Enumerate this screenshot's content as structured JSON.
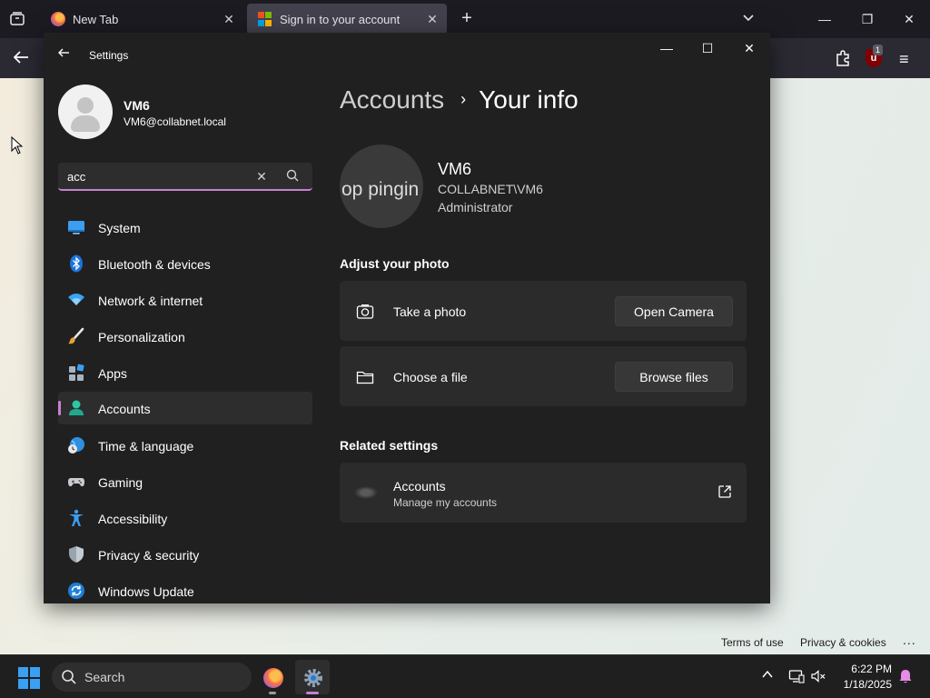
{
  "browser": {
    "tabs": [
      {
        "title": "New Tab"
      },
      {
        "title": "Sign in to your account"
      }
    ]
  },
  "web_footer": {
    "terms": "Terms of use",
    "privacy": "Privacy & cookies",
    "more": "..."
  },
  "settings": {
    "title": "Settings",
    "profile": {
      "name": "VM6",
      "email": "VM6@collabnet.local"
    },
    "search": {
      "value": "acc"
    },
    "nav": [
      {
        "label": "System",
        "icon": "monitor-icon"
      },
      {
        "label": "Bluetooth & devices",
        "icon": "bluetooth-icon"
      },
      {
        "label": "Network & internet",
        "icon": "wifi-icon"
      },
      {
        "label": "Personalization",
        "icon": "paintbrush-icon"
      },
      {
        "label": "Apps",
        "icon": "apps-icon"
      },
      {
        "label": "Accounts",
        "icon": "person-icon",
        "selected": true
      },
      {
        "label": "Time & language",
        "icon": "globe-clock-icon"
      },
      {
        "label": "Gaming",
        "icon": "gamepad-icon"
      },
      {
        "label": "Accessibility",
        "icon": "accessibility-icon"
      },
      {
        "label": "Privacy & security",
        "icon": "shield-icon"
      },
      {
        "label": "Windows Update",
        "icon": "sync-icon"
      }
    ],
    "breadcrumb": {
      "parent": "Accounts",
      "separator": "›",
      "current": "Your info"
    },
    "user": {
      "photo_text": "op pingin",
      "name": "VM6",
      "domain": "COLLABNET\\VM6",
      "role": "Administrator"
    },
    "adjust_photo": {
      "title": "Adjust your photo",
      "take_photo": {
        "label": "Take a photo",
        "button": "Open Camera"
      },
      "choose_file": {
        "label": "Choose a file",
        "button": "Browse files"
      }
    },
    "related": {
      "title": "Related settings",
      "accounts": {
        "label": "Accounts",
        "sub": "Manage my accounts"
      }
    }
  },
  "taskbar": {
    "search_label": "Search",
    "time": "6:22 PM",
    "date": "1/18/2025"
  },
  "colors": {
    "accent": "#c97fd3",
    "settings_bg": "#202020",
    "card_bg": "#2b2b2b"
  }
}
